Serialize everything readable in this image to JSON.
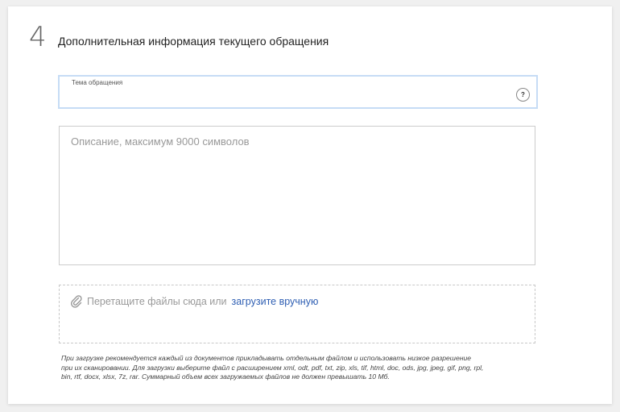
{
  "section": {
    "number": "4",
    "title": "Дополнительная информация текущего обращения"
  },
  "subject": {
    "label": "Тема обращения",
    "value": "",
    "help": "?"
  },
  "description": {
    "placeholder": "Описание, максимум 9000 символов",
    "value": ""
  },
  "upload": {
    "drop_text": "Перетащите файлы сюда или",
    "link_text": "загрузите вручную",
    "icon": "paperclip-icon"
  },
  "note": {
    "lines": [
      "При загрузке рекомендуется каждый из документов прикладывать отдельным файлом и использовать низкое разрешение",
      "при их сканировании. Для загрузки выберите файл с расширением xml, odt, pdf, txt, zip, xls, tif, html, doc, ods, jpg, jpeg, gif, png, rpl,",
      "bin, rtf, docx, xlsx, 7z, rar. Суммарный объем всех загружаемых файлов не должен превышать 10 Мб."
    ]
  },
  "colors": {
    "focus_border": "#c6dcf5",
    "link": "#2f5fb3",
    "placeholder": "#999999"
  }
}
